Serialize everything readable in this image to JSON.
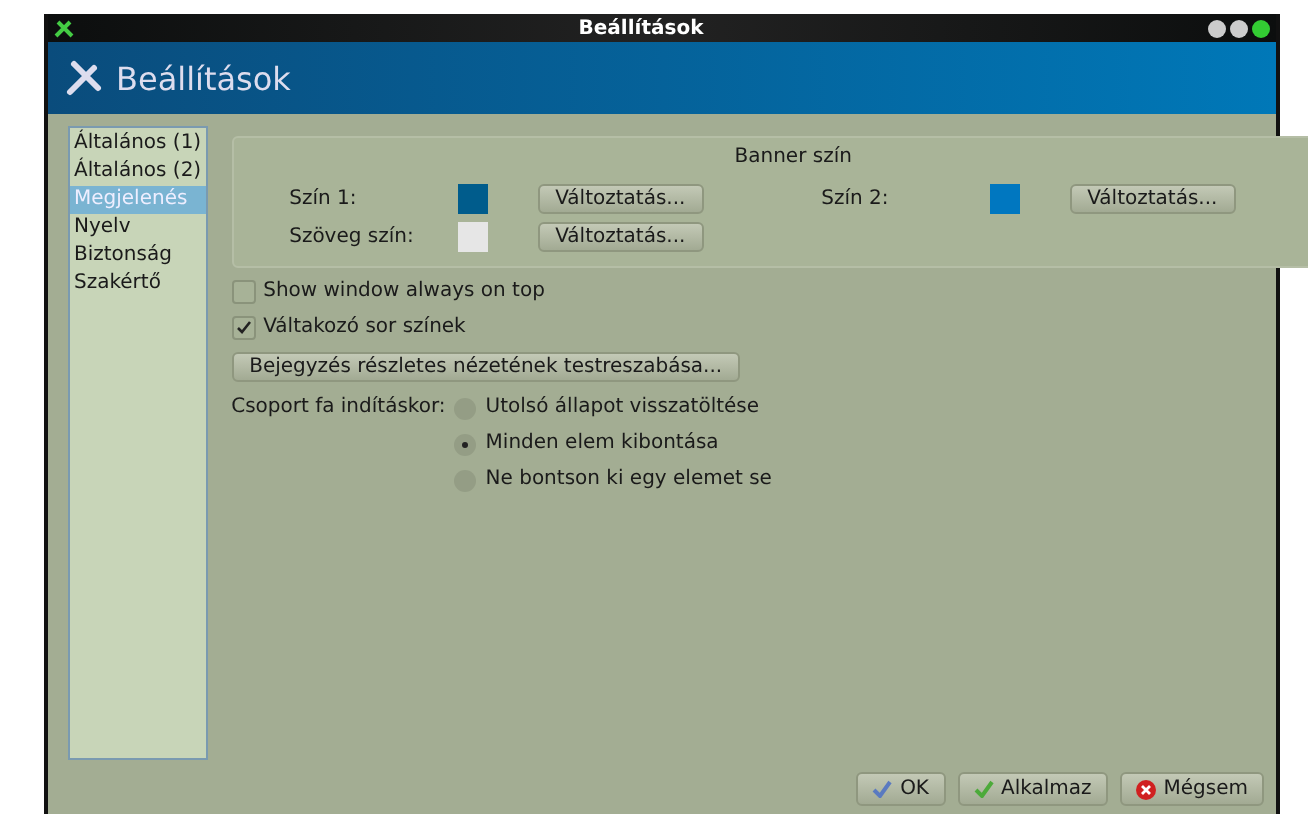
{
  "window": {
    "title": "Beállítások"
  },
  "header": {
    "title": "Beállítások"
  },
  "sidebar": {
    "items": [
      {
        "label": "Általános (1)",
        "selected": false
      },
      {
        "label": "Általános (2)",
        "selected": false
      },
      {
        "label": "Megjelenés",
        "selected": true
      },
      {
        "label": "Nyelv",
        "selected": false
      },
      {
        "label": "Biztonság",
        "selected": false
      },
      {
        "label": "Szakértő",
        "selected": false
      }
    ]
  },
  "banner_group": {
    "title": "Banner szín",
    "rows": [
      [
        {
          "label": "Szín 1:",
          "color": "#005c8c",
          "button": "Változtatás..."
        },
        {
          "label": "Szín 2:",
          "color": "#0077c0",
          "button": "Változtatás..."
        }
      ],
      [
        {
          "label": "Szöveg szín:",
          "color": "#e6e6e6",
          "button": "Változtatás..."
        }
      ]
    ]
  },
  "checkboxes": [
    {
      "label": "Show window always on top",
      "checked": false
    },
    {
      "label": "Váltakozó sor színek",
      "checked": true
    }
  ],
  "customize_button": "Bejegyzés részletes nézetének testreszabása...",
  "tree_start": {
    "label": "Csoport fa indításkor:",
    "options": [
      {
        "label": "Utolsó állapot visszatöltése",
        "selected": false
      },
      {
        "label": "Minden elem kibontása",
        "selected": true
      },
      {
        "label": "Ne bontson ki egy elemet se",
        "selected": false
      }
    ]
  },
  "buttons": [
    {
      "label": "OK",
      "kind": "ok"
    },
    {
      "label": "Alkalmaz",
      "kind": "apply"
    },
    {
      "label": "Mégsem",
      "kind": "cancel"
    }
  ]
}
